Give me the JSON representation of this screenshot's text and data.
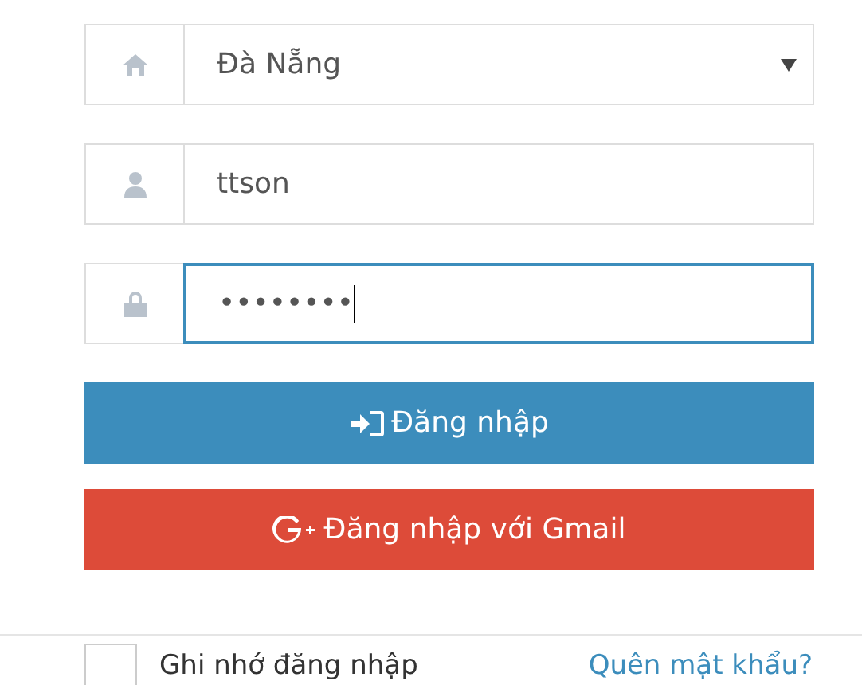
{
  "city_select": {
    "value": "Đà Nẵng"
  },
  "username_field": {
    "value": "ttson",
    "focused": false
  },
  "password_field": {
    "value": "••••••••",
    "focused": true
  },
  "buttons": [
    {
      "kind": "login",
      "label": "Đăng nhập"
    },
    {
      "kind": "gmail",
      "label": "Đăng nhập với Gmail"
    }
  ],
  "remember": {
    "label": "Ghi nhớ đăng nhập",
    "checked": false
  },
  "forgot_link": "Quên mật khẩu?"
}
